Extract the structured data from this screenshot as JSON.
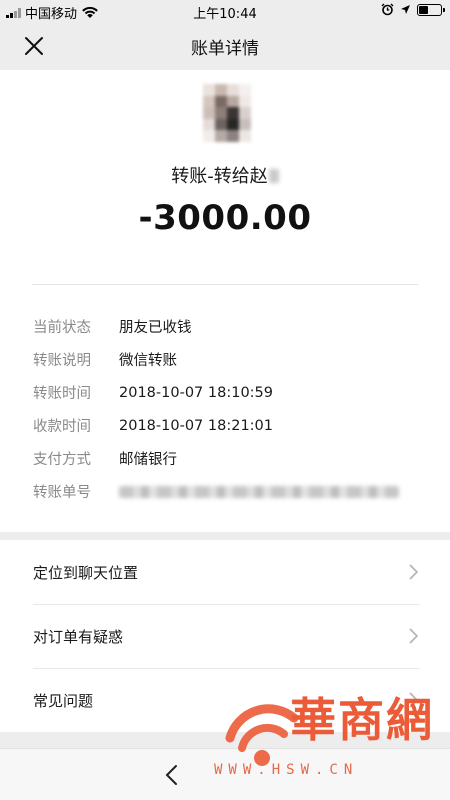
{
  "status_bar": {
    "carrier": "中国移动",
    "time": "上午10:44",
    "battery_level": 0.45
  },
  "nav": {
    "title": "账单详情"
  },
  "transfer": {
    "title": "转账-转给赵",
    "amount": "-3000.00"
  },
  "details": [
    {
      "label": "当前状态",
      "value": "朋友已收钱"
    },
    {
      "label": "转账说明",
      "value": "微信转账"
    },
    {
      "label": "转账时间",
      "value": "2018-10-07 18:10:59"
    },
    {
      "label": "收款时间",
      "value": "2018-10-07 18:21:01"
    },
    {
      "label": "支付方式",
      "value": "邮储银行"
    },
    {
      "label": "转账单号",
      "value": ""
    }
  ],
  "menu": [
    {
      "label": "定位到聊天位置"
    },
    {
      "label": "对订单有疑惑"
    },
    {
      "label": "常见问题"
    }
  ],
  "watermark": {
    "brand": "華商網",
    "url": "WWW.HSW.CN",
    "color": "#ec5b38"
  }
}
